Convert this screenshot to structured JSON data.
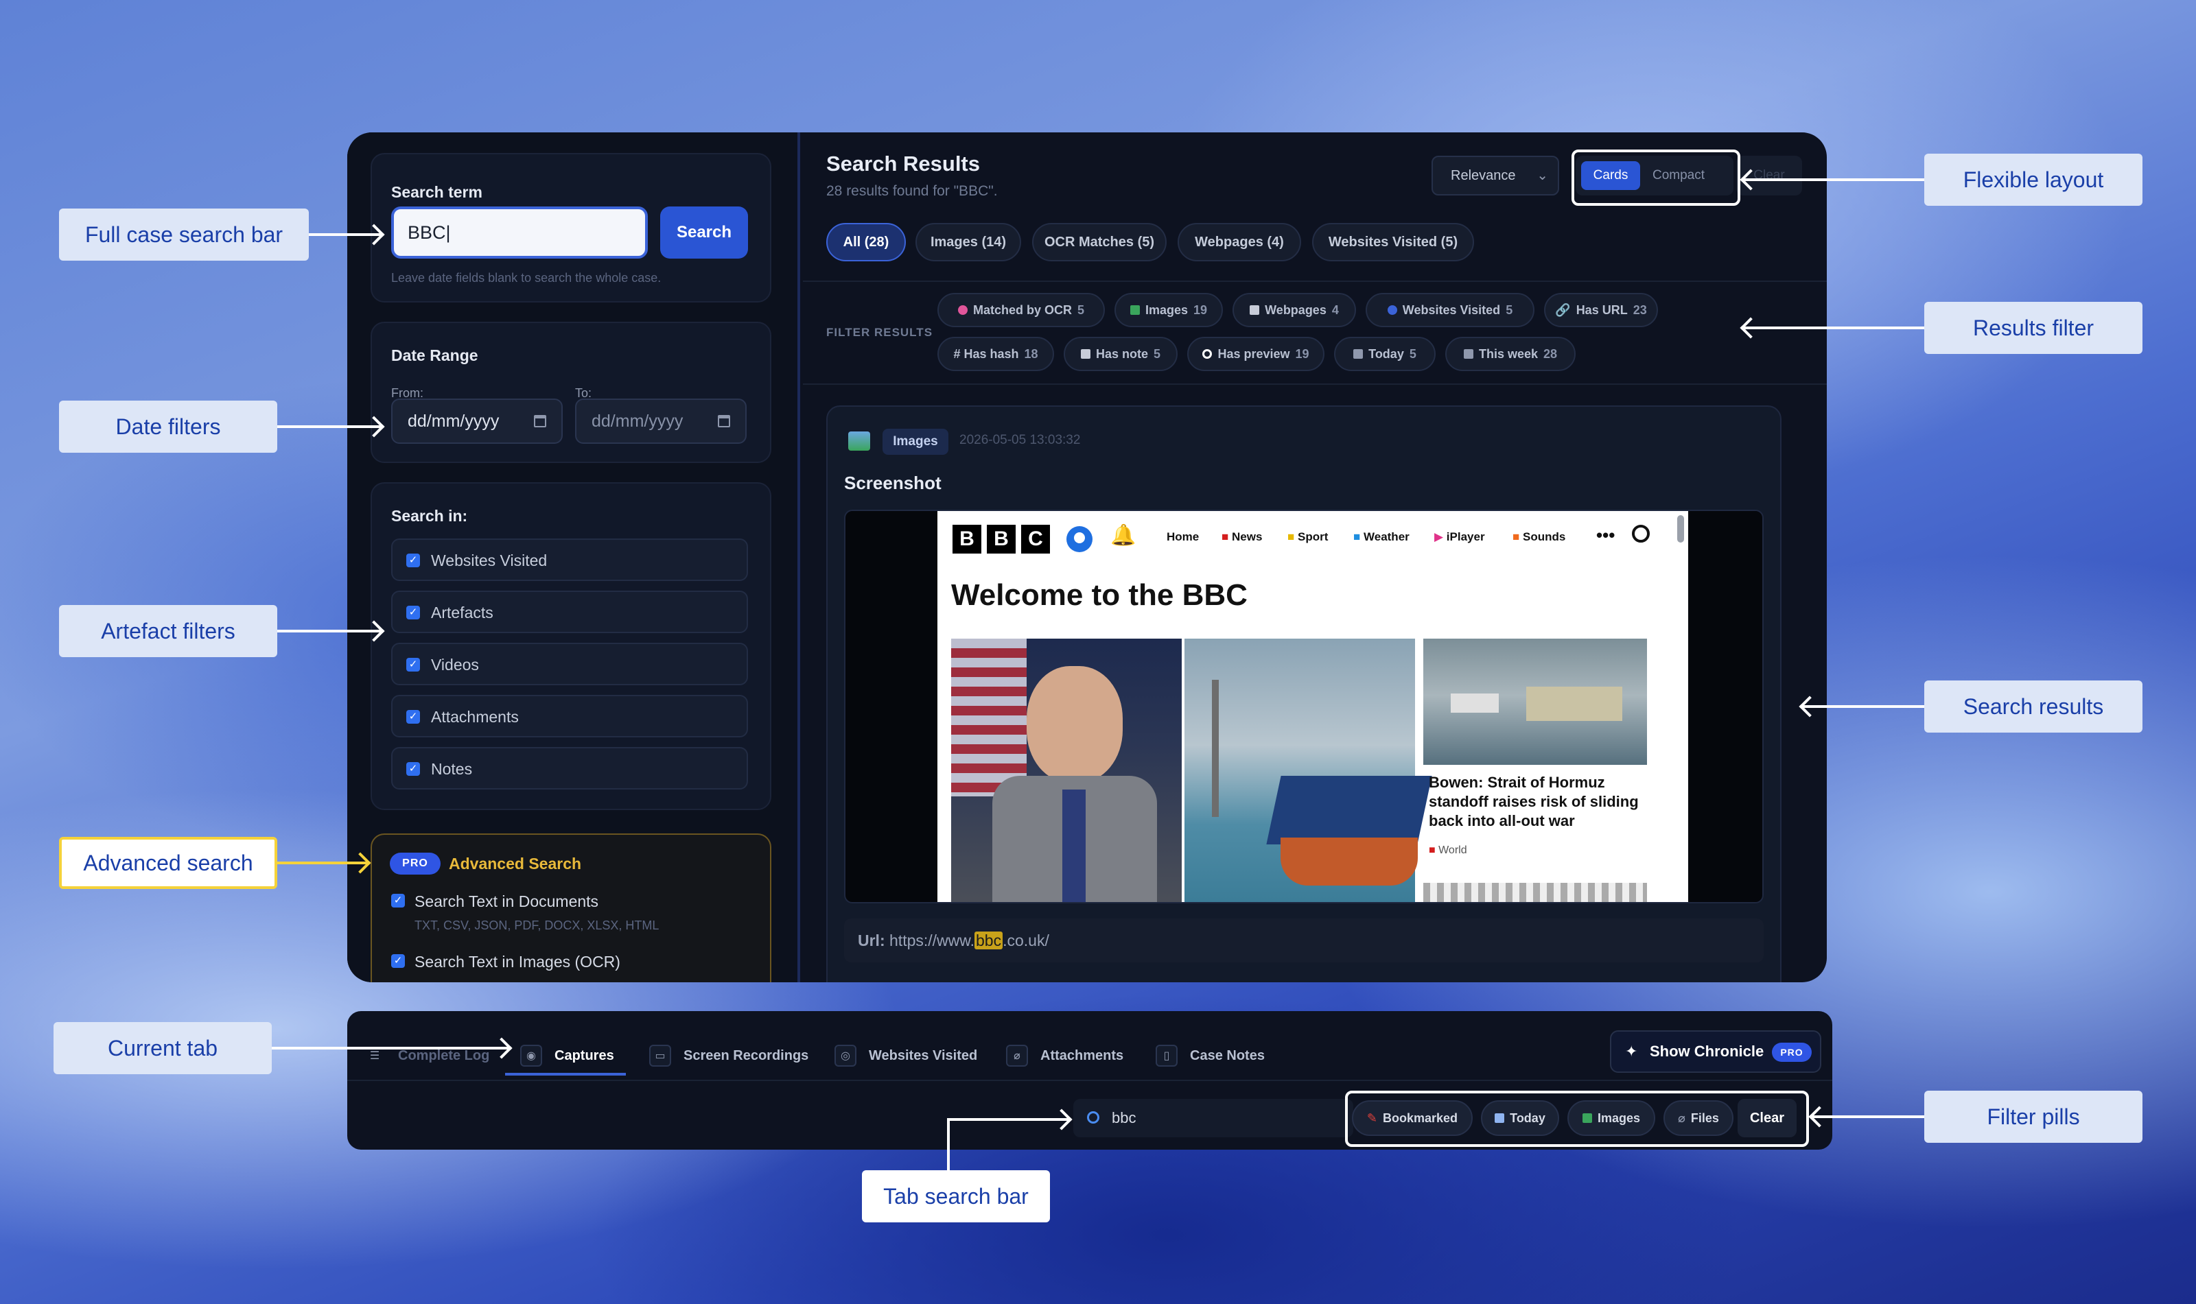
{
  "callouts": {
    "full_case_search_bar": "Full case search bar",
    "date_filters": "Date filters",
    "artefact_filters": "Artefact filters",
    "advanced_search": "Advanced search",
    "current_tab": "Current tab",
    "flexible_layout": "Flexible layout",
    "results_filter": "Results filter",
    "search_results": "Search results",
    "filter_pills": "Filter pills",
    "tab_search_bar": "Tab search bar"
  },
  "sidebar": {
    "search_term_title": "Search term",
    "search_value": "BBC",
    "search_button": "Search",
    "hint": "Leave date fields blank to search the whole case.",
    "date_range_title": "Date Range",
    "from_label": "From:",
    "to_label": "To:",
    "from_value": "dd/mm/yyyy",
    "to_value": "dd/mm/yyyy",
    "search_in_title": "Search in:",
    "search_in_items": [
      "Websites Visited",
      "Artefacts",
      "Videos",
      "Attachments",
      "Notes"
    ],
    "advanced": {
      "pro_badge": "PRO",
      "title": "Advanced Search",
      "opt1": "Search Text in Documents",
      "opt1_hint": "TXT, CSV, JSON, PDF, DOCX, XLSX, HTML",
      "opt2": "Search Text in Images (OCR)"
    }
  },
  "results": {
    "title": "Search Results",
    "subtitle": "28 results found for \"BBC\".",
    "sort_value": "Relevance",
    "layout_cards": "Cards",
    "layout_compact": "Compact",
    "clear": "Clear",
    "tabs": [
      "All (28)",
      "Images (14)",
      "OCR Matches (5)",
      "Webpages (4)",
      "Websites Visited (5)"
    ],
    "filter_label": "FILTER RESULTS",
    "filters": [
      {
        "label": "Matched by OCR",
        "count": "5",
        "color": "#e0559a"
      },
      {
        "label": "Images",
        "count": "19",
        "color": "#3aa55c"
      },
      {
        "label": "Webpages",
        "count": "4",
        "color": "#c7ccd8"
      },
      {
        "label": "Websites Visited",
        "count": "5",
        "color": "#3b63d8"
      },
      {
        "label": "Has URL",
        "count": "23",
        "color": "#8f98ad"
      },
      {
        "label": "# Has hash",
        "count": "18",
        "color": ""
      },
      {
        "label": "Has note",
        "count": "5",
        "color": "#c7ccd8"
      },
      {
        "label": "Has preview",
        "count": "19",
        "color": "#ffffff"
      },
      {
        "label": "Today",
        "count": "5",
        "color": "#8f98ad"
      },
      {
        "label": "This week",
        "count": "28",
        "color": "#8f98ad"
      }
    ],
    "card": {
      "category": "Images",
      "timestamp": "2026-05-05 13:03:32",
      "title": "Screenshot",
      "url_label": "Url:",
      "url_prefix": "https://www.",
      "url_highlight": "bbc",
      "url_suffix": ".co.uk/",
      "bbc": {
        "nav": [
          "Home",
          "News",
          "Sport",
          "Weather",
          "iPlayer",
          "Sounds"
        ],
        "heading": "Welcome to the BBC",
        "story": "Bowen: Strait of Hormuz standoff raises risk of sliding back into all-out war",
        "story_tag": "World"
      }
    }
  },
  "bottom": {
    "tabs": [
      "Complete Log",
      "Captures",
      "Screen Recordings",
      "Websites Visited",
      "Attachments",
      "Case Notes"
    ],
    "show_chronicle": "Show Chronicle",
    "pro_badge": "PRO",
    "search_value": "bbc",
    "pills": [
      "Bookmarked",
      "Today",
      "Images",
      "Files"
    ],
    "clear": "Clear"
  }
}
